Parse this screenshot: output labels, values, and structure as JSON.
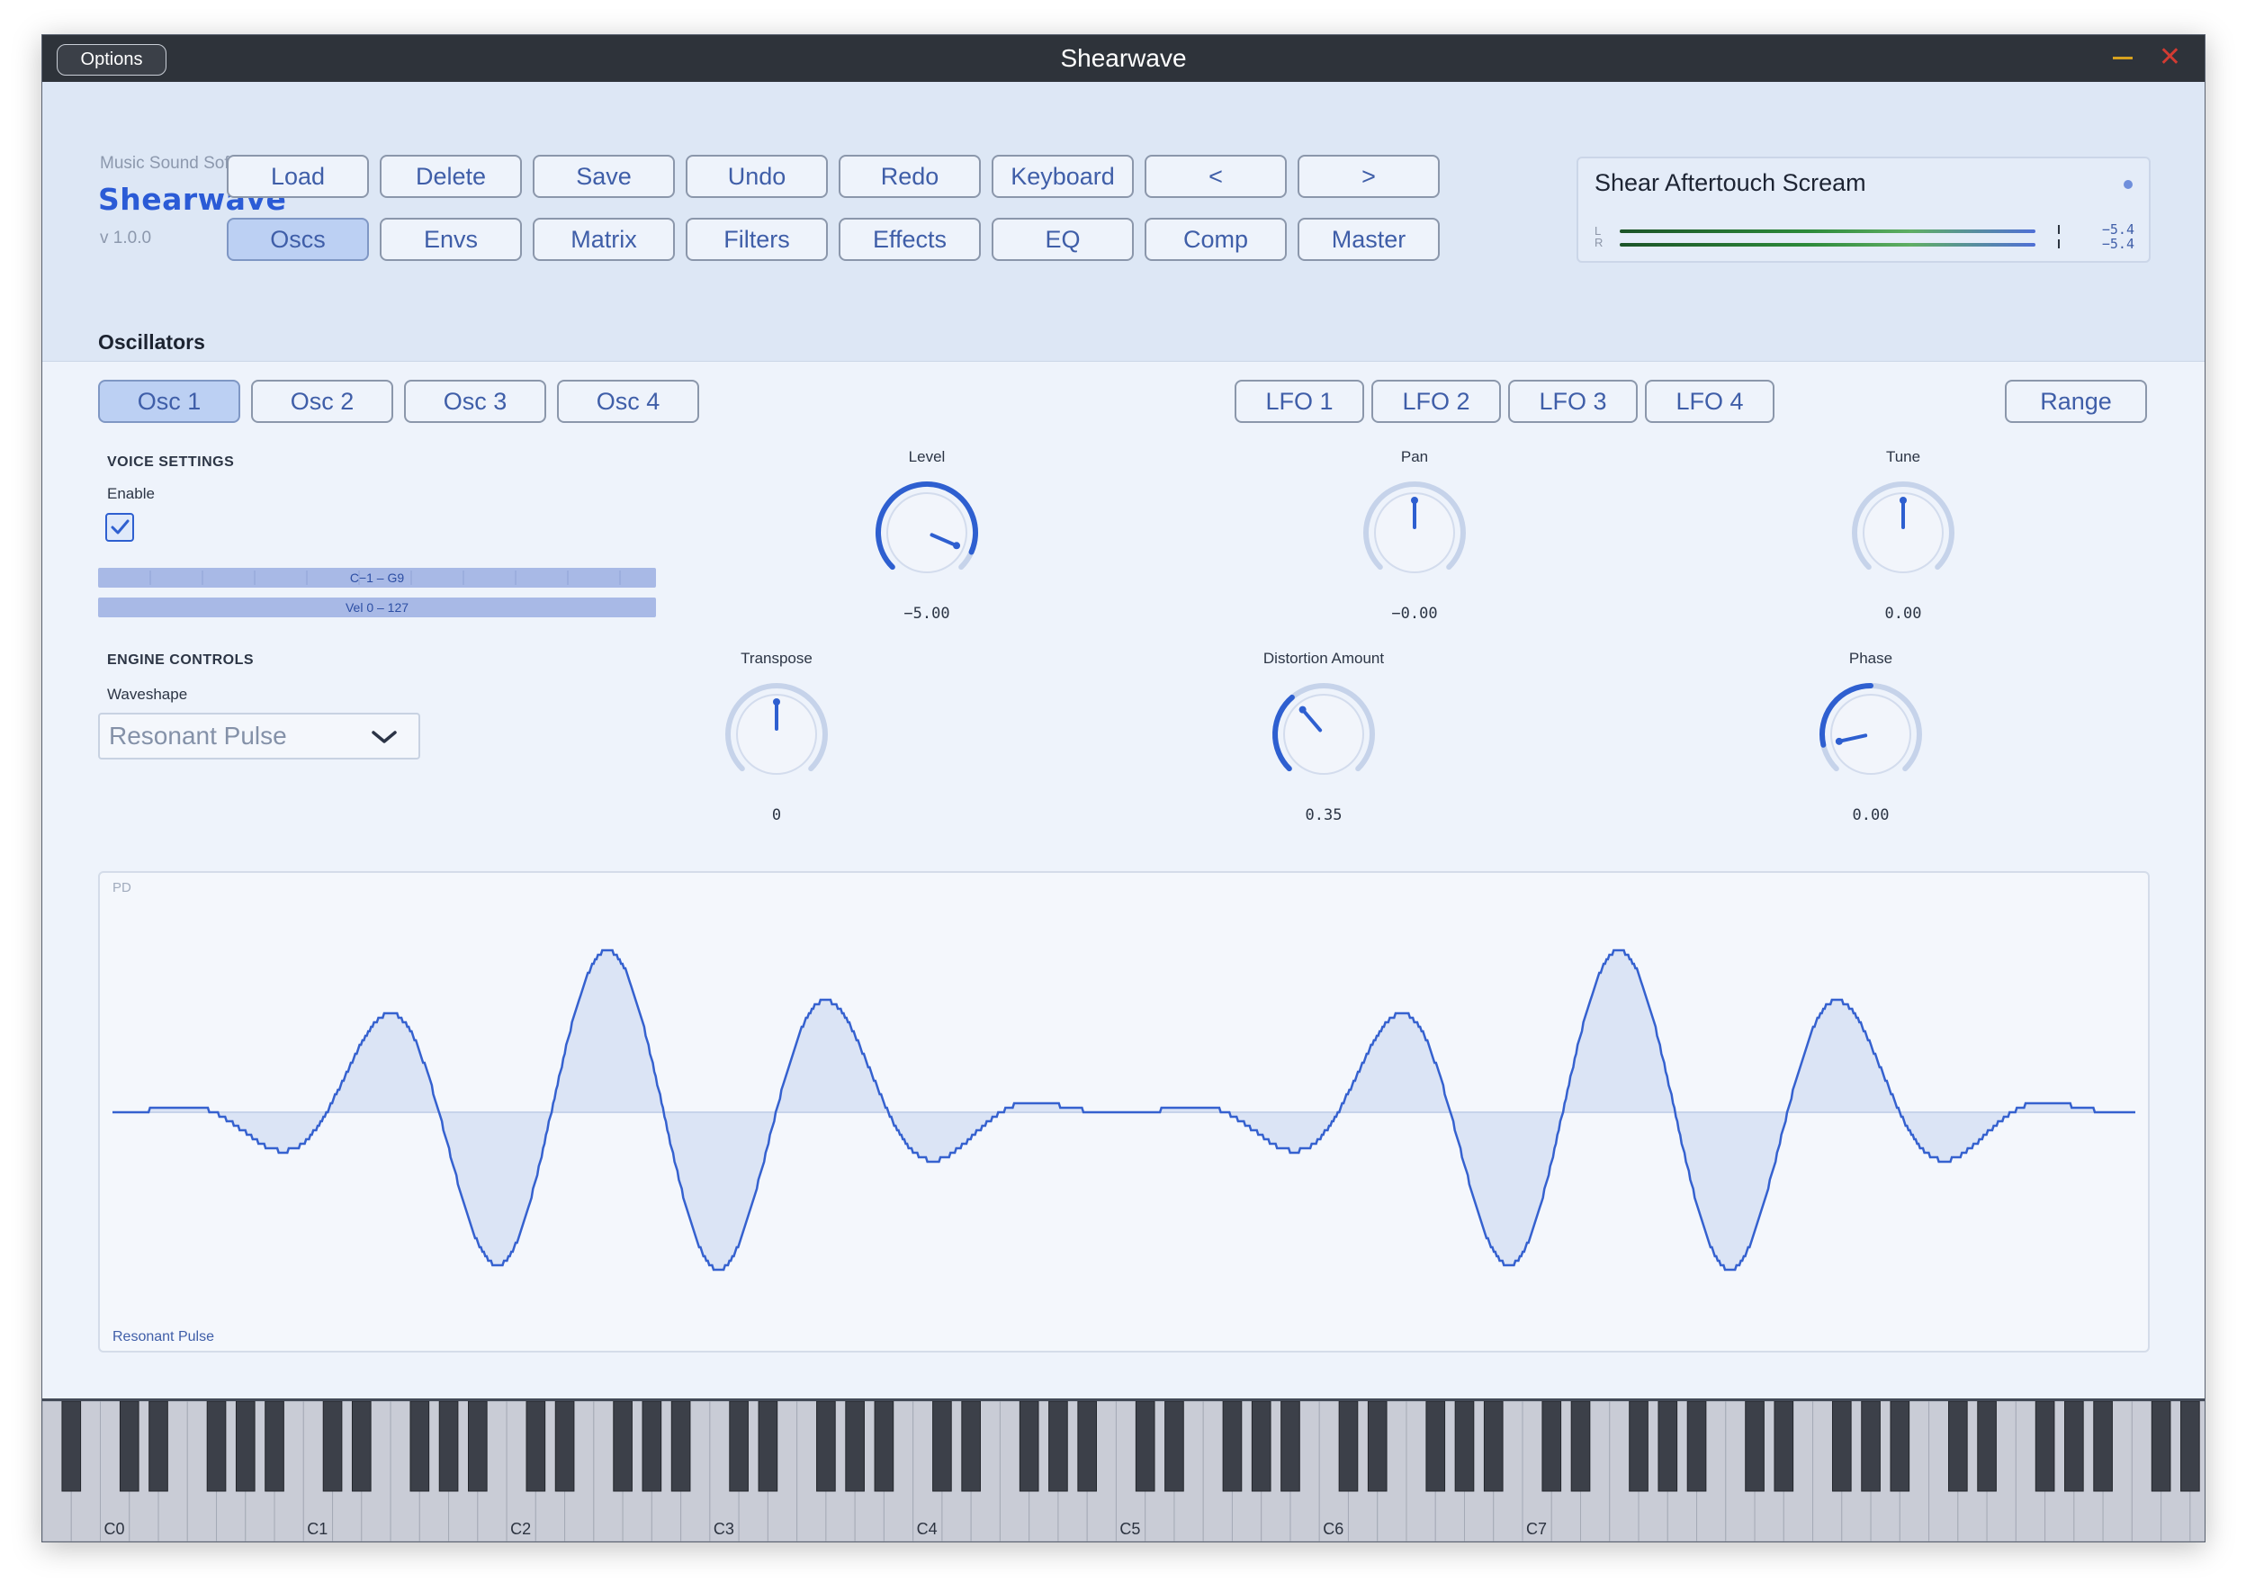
{
  "window": {
    "title": "Shearwave",
    "options_label": "Options",
    "close_glyph": "✕"
  },
  "brand": {
    "company": "Music Sound Software",
    "name": "Shearwave",
    "version": "v 1.0.0"
  },
  "toolbar": {
    "row1": [
      "Load",
      "Delete",
      "Save",
      "Undo",
      "Redo",
      "Keyboard",
      "<",
      ">"
    ],
    "row2": [
      "Oscs",
      "Envs",
      "Matrix",
      "Filters",
      "Effects",
      "EQ",
      "Comp",
      "Master"
    ],
    "active_row2": "Oscs"
  },
  "preset": {
    "name": "Shear Aftertouch Scream",
    "meter_left_label": "L",
    "meter_right_label": "R",
    "meter_left_value": "−5.4",
    "meter_right_value": "−5.4"
  },
  "section_title": "Oscillators",
  "osc_tabs": [
    "Osc 1",
    "Osc 2",
    "Osc 3",
    "Osc 4"
  ],
  "active_osc": "Osc 1",
  "lfo_tabs": [
    "LFO 1",
    "LFO 2",
    "LFO 3",
    "LFO 4"
  ],
  "range_label": "Range",
  "voice": {
    "heading": "VOICE SETTINGS",
    "enable_label": "Enable",
    "enabled": true,
    "key_range": "C−1 – G9",
    "vel_range": "Vel 0 – 127"
  },
  "engine": {
    "heading": "ENGINE CONTROLS",
    "waveshape_label": "Waveshape",
    "waveshape_value": "Resonant Pulse"
  },
  "knobs": {
    "level": {
      "label": "Level",
      "value": "−5.00",
      "fraction": 0.92
    },
    "pan": {
      "label": "Pan",
      "value": "−0.00",
      "fraction": 0.5
    },
    "tune": {
      "label": "Tune",
      "value": "0.00",
      "fraction": 0.5
    },
    "transpose": {
      "label": "Transpose",
      "value": "0",
      "fraction": 0.5
    },
    "distortion": {
      "label": "Distortion Amount",
      "value": "0.35",
      "fraction": 0.35
    },
    "phase": {
      "label": "Phase",
      "value": "0.00",
      "fraction": 0.12
    }
  },
  "waveform": {
    "corner_label": "PD",
    "name": "Resonant Pulse"
  },
  "keyboard": {
    "octave_labels": [
      "C0",
      "C1",
      "C2",
      "C3",
      "C4",
      "C5",
      "C6",
      "C7"
    ]
  },
  "colors": {
    "accent": "#2e5fd0",
    "panel": "#eef3fb",
    "header": "#dde7f5"
  }
}
